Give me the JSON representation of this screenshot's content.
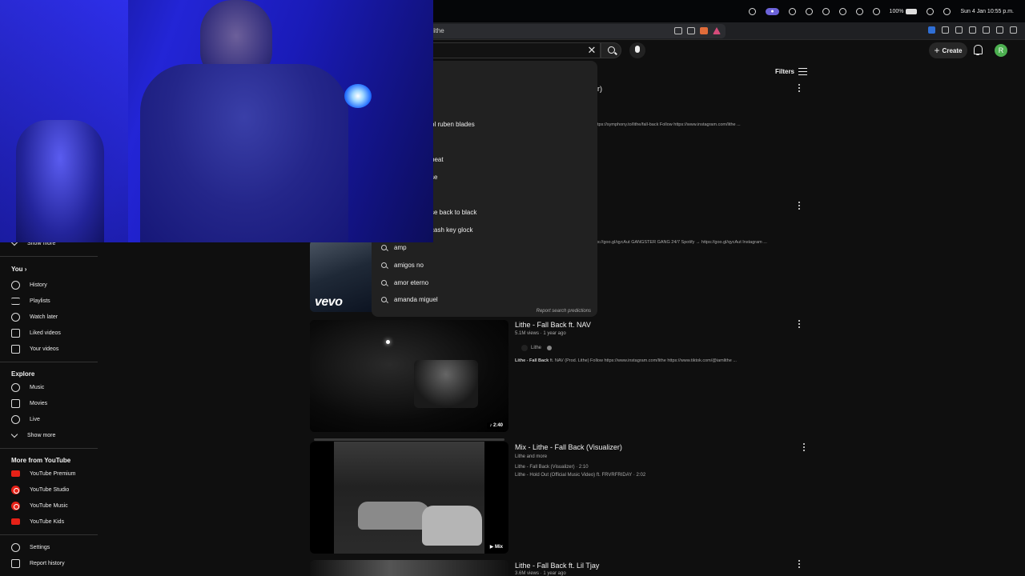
{
  "menubar": {
    "battery": "100%",
    "clock": "Sun 4 Jan  10:55 p.m."
  },
  "browser": {
    "url": "lithe"
  },
  "header": {
    "create_label": "Create",
    "avatar_initial": "R",
    "filters_label": "Filters"
  },
  "sidebar": {
    "show_more_top": "Show more",
    "you_heading": "You",
    "you_items": [
      "History",
      "Playlists",
      "Watch later",
      "Liked videos",
      "Your videos"
    ],
    "explore_heading": "Explore",
    "explore_items": [
      "Music",
      "Movies",
      "Live",
      "Show more"
    ],
    "more_heading": "More from YouTube",
    "more_items": [
      "YouTube Premium",
      "YouTube Studio",
      "YouTube Music",
      "YouTube Kids"
    ],
    "bottom_items": [
      "Settings",
      "Report history"
    ]
  },
  "suggestions": {
    "items": [
      "ol ruben blades",
      "beat",
      "se",
      "se back to black",
      "cash key glock",
      "amp",
      "amigos no",
      "amor eterno",
      "amanda miguel"
    ],
    "report": "Report search predictions"
  },
  "results": [
    {
      "title_partial": "r)",
      "desc": "tps://symphony.to/lithe/fall-back Follow https://www.instagram.com/lithe ..."
    },
    {
      "desc": "s://goo.gl/qycAut GANGSTER GANG 24/7 Spotify → https://goo.gl/qycAut Instagram ...",
      "thumb_brand": "vevo"
    },
    {
      "title": "Lithe - Fall Back ft. NAV",
      "meta": "5.1M views · 1 year ago",
      "channel": "Lithe",
      "desc_bold": "Lithe - Fall Back",
      "desc_rest": " ft. NAV (Prod. Lithe) Follow https://www.instagram.com/lithe https://www.tiktok.com/@iamlithe ...",
      "duration": "2:40"
    },
    {
      "title": "Mix - Lithe - Fall Back (Visualizer)",
      "meta": "Lithe and more",
      "track1": "Lithe - Fall Back (Visualizer) · 2:10",
      "track2": "Lithe - Hold Out (Official Music Video) ft. FRVRFRIDAY · 2:02",
      "badge": "Mix"
    },
    {
      "title": "Lithe - Fall Back ft. Lil Tjay",
      "meta": "3.6M views · 1 year ago"
    }
  ],
  "colors": {
    "background": "#0f0f0f",
    "webcam_blue": "#1a1bb8",
    "youtube_red": "#e62117",
    "avatar_green": "#4caf50"
  }
}
